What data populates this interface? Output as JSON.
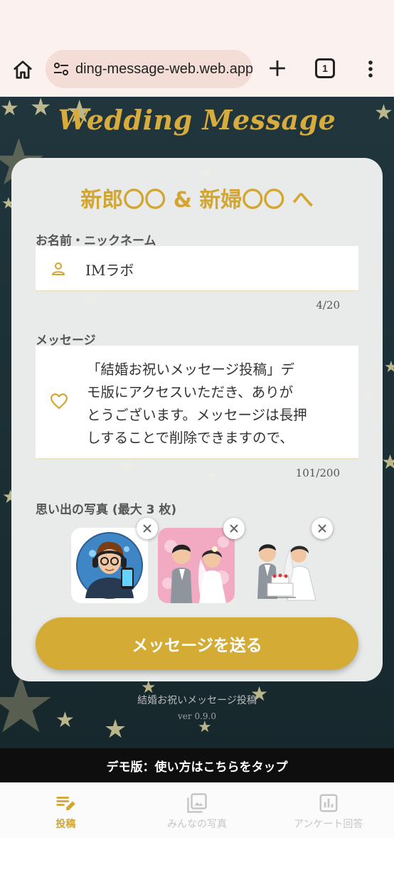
{
  "browser": {
    "url": "ding-message-web.web.app",
    "tab_count": "1"
  },
  "app": {
    "title": "Wedding Message"
  },
  "form": {
    "heading": "新郎〇〇 & 新婦〇〇 へ",
    "name_label": "お名前・ニックネーム",
    "name_value": "IMラボ",
    "name_counter": "4/20",
    "message_label": "メッセージ",
    "message_value": "「結婚お祝いメッセージ投稿」デ\nモ版にアクセスいただき、ありが\nとうございます。メッセージは長押\nしすることで削除できますので、",
    "message_counter": "101/200",
    "photos_label": "思い出の写真 (最大 3 枚)",
    "photos": [
      {
        "name": "avatar-photo"
      },
      {
        "name": "couple-photo"
      },
      {
        "name": "cake-cutting-photo"
      }
    ],
    "send_label": "メッセージを送る"
  },
  "footer": {
    "title": "結婚お祝いメッセージ投稿",
    "version": "ver 0.9.0"
  },
  "demo_banner": "デモ版：使い方はこちらをタップ",
  "nav": {
    "items": [
      {
        "label": "投稿",
        "icon": "edit-note-icon",
        "active": true
      },
      {
        "label": "みんなの写真",
        "icon": "photo-library-icon",
        "active": false
      },
      {
        "label": "アンケート回答",
        "icon": "bar-chart-icon",
        "active": false
      }
    ]
  },
  "colors": {
    "accent": "#d3ab35",
    "background": "#1b2f35",
    "card": "#e9eaea"
  }
}
